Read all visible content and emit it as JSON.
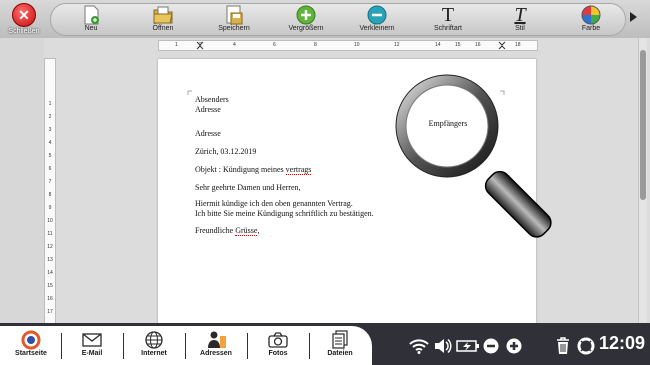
{
  "toolbar": {
    "close_label": "Schließen",
    "tools": [
      {
        "label": "Neu",
        "icon": "new-document-icon"
      },
      {
        "label": "Öffnen",
        "icon": "open-folder-icon"
      },
      {
        "label": "Speichern",
        "icon": "save-document-icon"
      },
      {
        "label": "Vergrößern",
        "icon": "zoom-in-icon"
      },
      {
        "label": "Verkleinern",
        "icon": "zoom-out-icon"
      },
      {
        "label": "Schriftart",
        "icon": "font-icon"
      },
      {
        "label": "Stil",
        "icon": "style-icon"
      },
      {
        "label": "Farbe",
        "icon": "color-palette-icon"
      }
    ]
  },
  "ruler": {
    "h_numbers": [
      "1",
      "2",
      "4",
      "6",
      "8",
      "10",
      "12",
      "14",
      "15",
      "16",
      "18"
    ],
    "v_numbers": [
      "1",
      "2",
      "3",
      "4",
      "5",
      "6",
      "7",
      "8",
      "9",
      "10",
      "11",
      "12",
      "13",
      "14",
      "15",
      "16",
      "17"
    ]
  },
  "document": {
    "lines": {
      "sender": "Absenders",
      "sender_address": "Adresse",
      "address": "Adresse",
      "date": "Zürich, 03.12.2019",
      "subject_prefix": "Objekt : Kündigung meines ",
      "subject_word": "vertrags",
      "salutation": "Sehr geehrte Damen und Herren,",
      "body1": "Hiermit kündige ich den oben genannten Vertrag.",
      "body2": "Ich bitte Sie meine Kündigung schriftlich zu bestätigen.",
      "closing_prefix": "Freundliche ",
      "closing_word": "Grüsse",
      "closing_suffix": ","
    },
    "magnifier_text": "Empfängers"
  },
  "taskbar": {
    "apps": [
      {
        "label": "Startseite",
        "icon": "home-logo-icon"
      },
      {
        "label": "E-Mail",
        "icon": "email-icon"
      },
      {
        "label": "Internet",
        "icon": "globe-icon"
      },
      {
        "label": "Adressen",
        "icon": "contacts-icon"
      },
      {
        "label": "Fotos",
        "icon": "camera-icon"
      },
      {
        "label": "Dateien",
        "icon": "files-icon"
      }
    ],
    "tray_icons": [
      "wifi-icon",
      "volume-icon",
      "battery-icon",
      "minus-icon",
      "plus-icon",
      "night-mode-icon",
      "trash-icon",
      "help-lifebuoy-icon"
    ],
    "clock": "12:09"
  }
}
